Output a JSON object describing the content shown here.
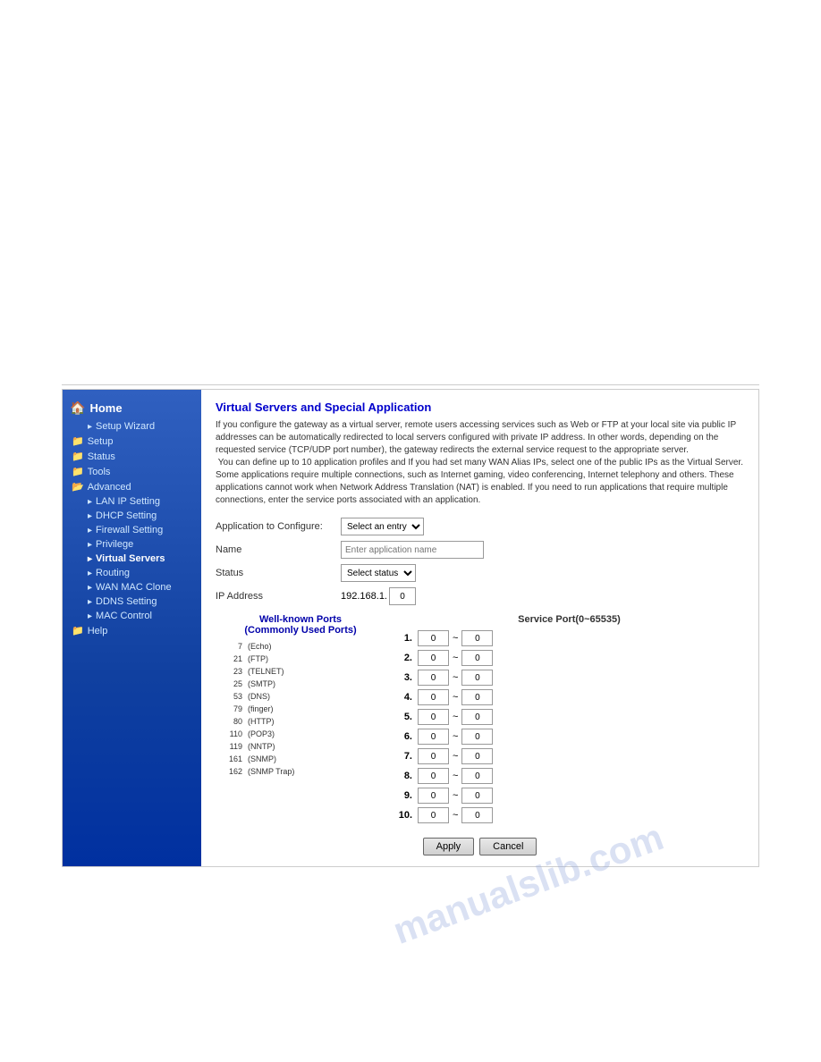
{
  "sidebar": {
    "home_label": "Home",
    "items": [
      {
        "label": "Setup Wizard",
        "level": "sub",
        "icon": "▸"
      },
      {
        "label": "Setup",
        "level": "section",
        "icon": "📁"
      },
      {
        "label": "Status",
        "level": "section",
        "icon": "📁"
      },
      {
        "label": "Tools",
        "level": "section",
        "icon": "📁"
      },
      {
        "label": "Advanced",
        "level": "section",
        "icon": "📁"
      },
      {
        "label": "LAN IP Setting",
        "level": "subsub",
        "icon": "▸"
      },
      {
        "label": "DHCP Setting",
        "level": "subsub",
        "icon": "▸"
      },
      {
        "label": "Firewall Setting",
        "level": "subsub",
        "icon": "▸"
      },
      {
        "label": "Privilege",
        "level": "subsub",
        "icon": "▸"
      },
      {
        "label": "Virtual Servers",
        "level": "subsub",
        "icon": "▸",
        "active": true
      },
      {
        "label": "Routing",
        "level": "subsub",
        "icon": "▸"
      },
      {
        "label": "WAN MAC Clone",
        "level": "subsub",
        "icon": "▸"
      },
      {
        "label": "DDNS Setting",
        "level": "subsub",
        "icon": "▸"
      },
      {
        "label": "MAC Control",
        "level": "subsub",
        "icon": "▸"
      },
      {
        "label": "Help",
        "level": "section",
        "icon": "📁"
      }
    ]
  },
  "content": {
    "title": "Virtual Servers and Special Application",
    "description": "If you configure the gateway as a virtual server, remote users accessing services such as Web or FTP at your local site via public IP addresses can be automatically redirected to local servers configured with private IP address. In other words, depending on the requested service (TCP/UDP port number), the gateway redirects the external service request to the appropriate server.\n You can define up to 10 application profiles and If you had set many WAN Alias IPs, select one of the public IPs as the Virtual Server. Some applications require multiple connections, such as Internet gaming, video conferencing, Internet telephony and others. These applications cannot work when Network Address Translation (NAT) is enabled. If you need to run applications that require multiple connections, enter the service ports associated with an application.",
    "form": {
      "app_to_configure_label": "Application to Configure:",
      "app_to_configure_select": "Select an entry",
      "name_label": "Name",
      "name_placeholder": "Enter application name",
      "status_label": "Status",
      "status_select": "Select status",
      "ip_address_label": "IP Address",
      "ip_static": "192.168.1.",
      "ip_last_octet": "0"
    },
    "service_ports": {
      "title": "Service Port(0~65535)",
      "rows": [
        {
          "num": "1.",
          "from": "0",
          "to": "0"
        },
        {
          "num": "2.",
          "from": "0",
          "to": "0"
        },
        {
          "num": "3.",
          "from": "0",
          "to": "0"
        },
        {
          "num": "4.",
          "from": "0",
          "to": "0"
        },
        {
          "num": "5.",
          "from": "0",
          "to": "0"
        },
        {
          "num": "6.",
          "from": "0",
          "to": "0"
        },
        {
          "num": "7.",
          "from": "0",
          "to": "0"
        },
        {
          "num": "8.",
          "from": "0",
          "to": "0"
        },
        {
          "num": "9.",
          "from": "0",
          "to": "0"
        },
        {
          "num": "10.",
          "from": "0",
          "to": "0"
        }
      ]
    },
    "well_known": {
      "title": "Well-known Ports",
      "subtitle": "(Commonly Used Ports)",
      "entries": [
        {
          "port": "7",
          "name": "(Echo)"
        },
        {
          "port": "21",
          "name": "(FTP)"
        },
        {
          "port": "23",
          "name": "(TELNET)"
        },
        {
          "port": "25",
          "name": "(SMTP)"
        },
        {
          "port": "53",
          "name": "(DNS)"
        },
        {
          "port": "79",
          "name": "(finger)"
        },
        {
          "port": "80",
          "name": "(HTTP)"
        },
        {
          "port": "110",
          "name": "(POP3)"
        },
        {
          "port": "119",
          "name": "(NNTP)"
        },
        {
          "port": "161",
          "name": "(SNMP)"
        },
        {
          "port": "162",
          "name": "(SNMP Trap)"
        }
      ]
    },
    "buttons": {
      "apply": "Apply",
      "cancel": "Cancel"
    }
  },
  "watermark": "manualslib.com"
}
